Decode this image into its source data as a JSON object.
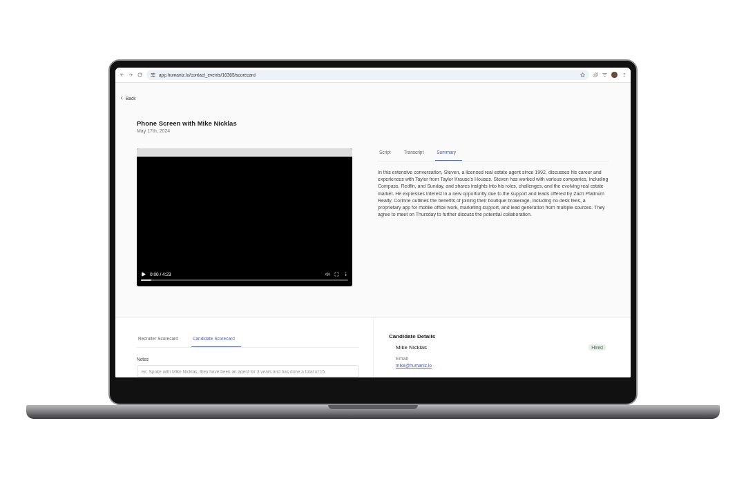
{
  "browser": {
    "url": "app.humaniz.io/contact_events/16365/scorecard"
  },
  "back": {
    "label": "Back"
  },
  "header": {
    "title": "Phone Screen with Mike Nicklas",
    "date": "May 17th, 2024"
  },
  "video": {
    "time": "0:00 / 4:23",
    "level": 0.05
  },
  "tabs": [
    {
      "label": "Script",
      "selected": false
    },
    {
      "label": "Transcript",
      "selected": false
    },
    {
      "label": "Summary",
      "selected": true
    }
  ],
  "summary": "In this extensive conversation, Steven, a licensed real estate agent since 1992, discusses his career and experiences with Taylor from Taylor Krause's Houses. Steven has worked with various companies, including Compass, Redfin, and Sunday, and shares insights into his roles, challenges, and the evolving real estate market. He expresses interest in a new opportunity due to the support and leads offered by Zach Platinum Realty. Corinne outlines the benefits of joining their boutique brokerage, including no desk fees, a proprietary app for mobile office work, marketing support, and lead generation from multiple sources. They agree to meet on Thursday to further discuss the potential collaboration.",
  "scorecard_tabs": [
    {
      "label": "Recruiter Scorecard",
      "selected": false
    },
    {
      "label": "Candidate Scorecard",
      "selected": true
    }
  ],
  "notes": {
    "label": "Notes",
    "placeholder": "ex: Spoke with Mike Nicklas, they have been an agent for 3 years and has done a total of 15"
  },
  "candidate": {
    "heading": "Candidate Details",
    "name": "Mike Nicklas",
    "status": "Hired",
    "email_label": "Email",
    "email": "mike@humaniz.io"
  }
}
